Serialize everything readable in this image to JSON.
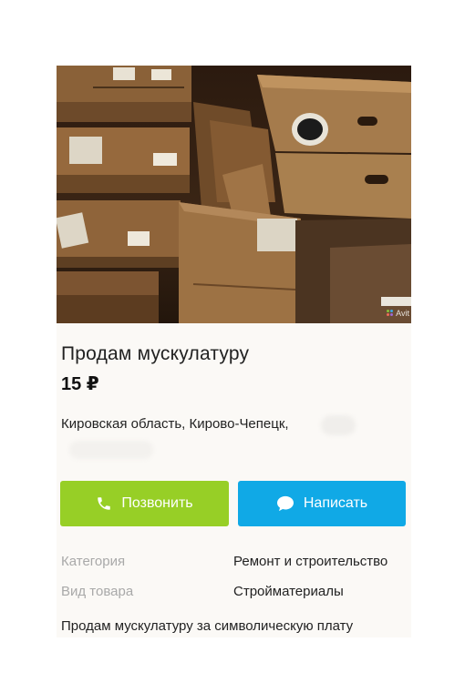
{
  "listing": {
    "title": "Продам мускулатуру",
    "price": "15 ₽",
    "location": "Кировская область, Кирово-Чепецк,",
    "watermark": "Avit",
    "description": "Продам мускулатуру за символическую плату"
  },
  "actions": {
    "call_label": "Позвонить",
    "write_label": "Написать",
    "call_color": "#97cf26",
    "write_color": "#10a9e6"
  },
  "details": [
    {
      "label": "Категория",
      "value": "Ремонт и строительство"
    },
    {
      "label": "Вид товара",
      "value": "Стройматериалы"
    }
  ],
  "icons": {
    "call": "phone-icon",
    "write": "chat-bubble-icon",
    "watermark": "avito-logo-icon"
  }
}
